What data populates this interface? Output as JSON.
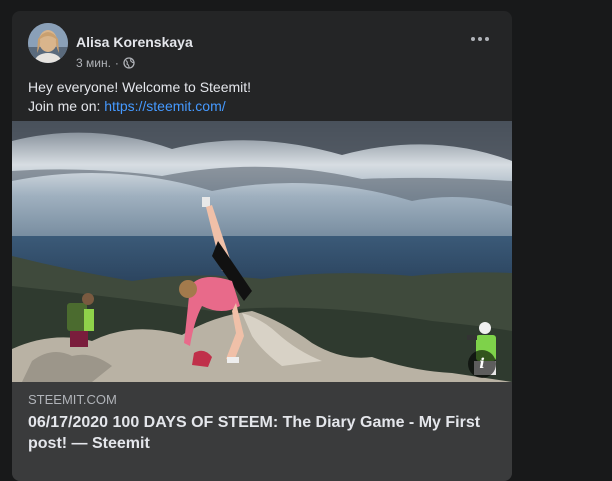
{
  "post": {
    "author": "Alisa Korenskaya",
    "time": "3 мин.",
    "separator": "·",
    "privacy_icon": "globe-icon",
    "text_line1": "Hey everyone! Welcome to Steemit!",
    "text_line2_prefix": "Join me on: ",
    "link_text": "https://steemit.com/"
  },
  "link_preview": {
    "domain": "STEEMIT.COM",
    "title": "06/17/2020 100 DAYS OF STEEM: The Diary Game - My First post! — Steemit",
    "info_label": "i"
  },
  "colors": {
    "background": "#18191a",
    "card": "#242526",
    "preview": "#3a3b3c",
    "link": "#4599ff"
  }
}
